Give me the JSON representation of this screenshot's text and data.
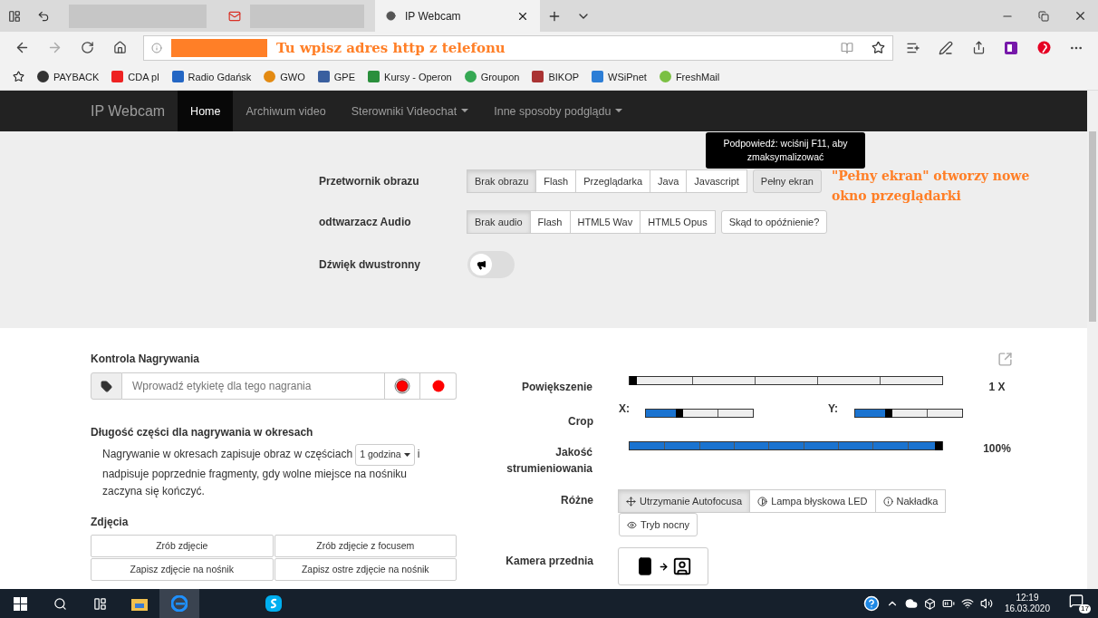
{
  "browser": {
    "tabs": [
      {
        "kind": "blank",
        "selected": false
      },
      {
        "kind": "mail",
        "selected": false
      },
      {
        "kind": "page",
        "title": "IP Webcam",
        "selected": true
      }
    ],
    "address": {
      "annotation": "Tu wpisz adres http z telefonu"
    },
    "bookmarks": [
      "PAYBACK",
      "CDA pl",
      "Radio Gdańsk",
      "GWO",
      "GPE",
      "Kursy - Operon",
      "Groupon",
      "BIKOP",
      "WSiPnet",
      "FreshMail"
    ]
  },
  "navbar": {
    "brand": "IP Webcam",
    "items": [
      {
        "label": "Home",
        "selected": true,
        "dropdown": false
      },
      {
        "label": "Archiwum video",
        "selected": false,
        "dropdown": false
      },
      {
        "label": "Sterowniki Videochat",
        "selected": false,
        "dropdown": true
      },
      {
        "label": "Inne sposoby podglądu",
        "selected": false,
        "dropdown": true
      }
    ]
  },
  "tooltip": "Podpowiedź: wciśnij F11, aby zmaksymalizować",
  "fullscreen_note": "\"Pełny ekran\" otworzy nowe okno przeglądarki",
  "settings": [
    {
      "kind": "buttons",
      "label": "Przetwornik obrazu",
      "options": [
        {
          "label": "Brak obrazu",
          "selected": true
        },
        {
          "label": "Flash",
          "selected": false
        },
        {
          "label": "Przeglądarka",
          "selected": false
        },
        {
          "label": "Java",
          "selected": false
        },
        {
          "label": "Javascript",
          "selected": false
        }
      ],
      "extra": {
        "label": "Pełny ekran",
        "highlighted": true
      }
    },
    {
      "kind": "buttons",
      "label": "odtwarzacz Audio",
      "options": [
        {
          "label": "Brak audio",
          "selected": true
        },
        {
          "label": "Flash",
          "selected": false
        },
        {
          "label": "HTML5 Wav",
          "selected": false
        },
        {
          "label": "HTML5 Opus",
          "selected": false
        }
      ],
      "extra": {
        "label": "Skąd to opóźnienie?",
        "highlighted": false
      }
    },
    {
      "kind": "toggle",
      "label": "Dźwięk dwustronny",
      "on": false
    }
  ],
  "recording": {
    "title": "Kontrola Nagrywania",
    "placeholder": "Wprowadź etykietę dla tego nagrania"
  },
  "periods": {
    "title": "Długość części dla nagrywania w okresach",
    "text_before": "Nagrywanie w okresach zapisuje obraz w częściach",
    "interval": "1 godzina",
    "text_after": "i",
    "text_continued": "nadpisuje poprzednie fragmenty, gdy wolne miejsce na nośniku zaczyna się kończyć."
  },
  "photos": {
    "title": "Zdjęcia",
    "buttons": [
      "Zrób zdjęcie",
      "Zrób zdjęcie z focusem",
      "Zapisz zdjęcie na nośnik",
      "Zapisz ostre zdjęcie na nośnik"
    ]
  },
  "controls": [
    {
      "kind": "slider",
      "label": "Powiększenie",
      "level": 0,
      "reading": "1 X"
    },
    {
      "kind": "crop",
      "label": "Crop",
      "axes": [
        {
          "label": "X:",
          "level": 0.3
        },
        {
          "label": "Y:",
          "level": 0.3
        }
      ]
    },
    {
      "kind": "slider",
      "label": "Jakość strumieniowania",
      "level": 1,
      "reading": "100%"
    },
    {
      "kind": "toggles",
      "label": "Różne",
      "options": [
        {
          "label": "Utrzymanie Autofocusa",
          "selected": true
        },
        {
          "label": "Lampa błyskowa LED",
          "selected": false
        },
        {
          "label": "Nakładka",
          "selected": false
        },
        {
          "label": "Tryb nocny",
          "selected": false
        }
      ]
    },
    {
      "kind": "camera",
      "label": "Kamera przednia"
    }
  ],
  "taskbar": {
    "time": "12:19",
    "date": "16.03.2020",
    "notifications": "17"
  }
}
